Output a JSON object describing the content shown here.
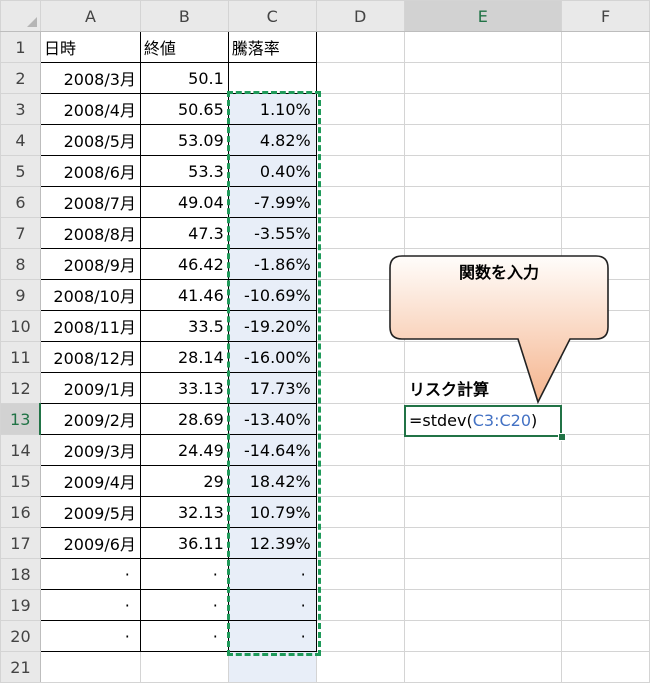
{
  "columns": [
    "A",
    "B",
    "C",
    "D",
    "E",
    "F"
  ],
  "rows": [
    {
      "num": "1",
      "a": "日時",
      "b": "終値",
      "c": "騰落率"
    },
    {
      "num": "2",
      "a": "2008/3月",
      "b": "50.1",
      "c": ""
    },
    {
      "num": "3",
      "a": "2008/4月",
      "b": "50.65",
      "c": "1.10%"
    },
    {
      "num": "4",
      "a": "2008/5月",
      "b": "53.09",
      "c": "4.82%"
    },
    {
      "num": "5",
      "a": "2008/6月",
      "b": "53.3",
      "c": "0.40%"
    },
    {
      "num": "6",
      "a": "2008/7月",
      "b": "49.04",
      "c": "-7.99%"
    },
    {
      "num": "7",
      "a": "2008/8月",
      "b": "47.3",
      "c": "-3.55%"
    },
    {
      "num": "8",
      "a": "2008/9月",
      "b": "46.42",
      "c": "-1.86%"
    },
    {
      "num": "9",
      "a": "2008/10月",
      "b": "41.46",
      "c": "-10.69%"
    },
    {
      "num": "10",
      "a": "2008/11月",
      "b": "33.5",
      "c": "-19.20%"
    },
    {
      "num": "11",
      "a": "2008/12月",
      "b": "28.14",
      "c": "-16.00%"
    },
    {
      "num": "12",
      "a": "2009/1月",
      "b": "33.13",
      "c": "17.73%"
    },
    {
      "num": "13",
      "a": "2009/2月",
      "b": "28.69",
      "c": "-13.40%"
    },
    {
      "num": "14",
      "a": "2009/3月",
      "b": "24.49",
      "c": "-14.64%"
    },
    {
      "num": "15",
      "a": "2009/4月",
      "b": "29",
      "c": "18.42%"
    },
    {
      "num": "16",
      "a": "2009/5月",
      "b": "32.13",
      "c": "10.79%"
    },
    {
      "num": "17",
      "a": "2009/6月",
      "b": "36.11",
      "c": "12.39%"
    },
    {
      "num": "18",
      "a": "·",
      "b": "·",
      "c": "·"
    },
    {
      "num": "19",
      "a": "·",
      "b": "·",
      "c": "·"
    },
    {
      "num": "20",
      "a": "·",
      "b": "·",
      "c": "·"
    },
    {
      "num": "21",
      "a": "",
      "b": "",
      "c": ""
    }
  ],
  "risk_label": "リスク計算",
  "formula": {
    "prefix": "=stdev(",
    "range": "C3:C20",
    "suffix": ")"
  },
  "callout": "関数を入力",
  "colors": {
    "accent": "#217346",
    "copy_border": "#1f9a5a",
    "range_fill": "#e8eef8",
    "ref_blue": "#4472c4",
    "callout_top": "#fffdfb",
    "callout_bottom": "#f5b48d"
  }
}
